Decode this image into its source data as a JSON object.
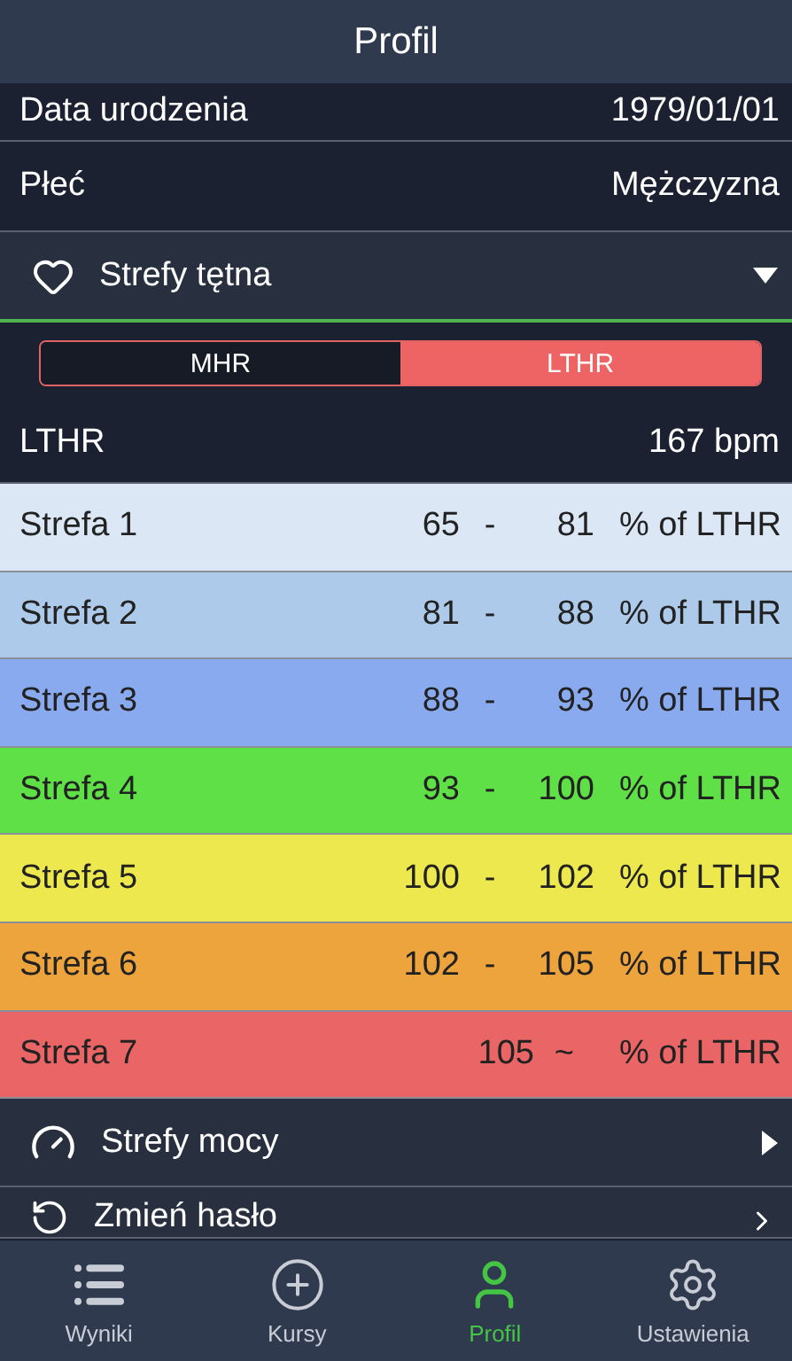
{
  "header": {
    "title": "Profil"
  },
  "fields": [
    {
      "label": "Data urodzenia",
      "value": "1979/01/01"
    },
    {
      "label": "Płeć",
      "value": "Mężczyzna"
    }
  ],
  "heart_section": {
    "title": "Strefy tętna",
    "expanded": true
  },
  "toggle": [
    {
      "label": "MHR",
      "selected": false
    },
    {
      "label": "LTHR",
      "selected": true
    }
  ],
  "threshold": {
    "label": "LTHR",
    "value": "167 bpm"
  },
  "zones": [
    {
      "name": "Strefa 1",
      "low": "65",
      "sep": "-",
      "high": "81",
      "unit": "% of LTHR",
      "color": "#dbe7f4"
    },
    {
      "name": "Strefa 2",
      "low": "81",
      "sep": "-",
      "high": "88",
      "unit": "% of LTHR",
      "color": "#aecaea"
    },
    {
      "name": "Strefa 3",
      "low": "88",
      "sep": "-",
      "high": "93",
      "unit": "% of LTHR",
      "color": "#8aaaf0"
    },
    {
      "name": "Strefa 4",
      "low": "93",
      "sep": "-",
      "high": "100",
      "unit": "% of LTHR",
      "color": "#5ee046"
    },
    {
      "name": "Strefa 5",
      "low": "100",
      "sep": "-",
      "high": "102",
      "unit": "% of LTHR",
      "color": "#ece84e"
    },
    {
      "name": "Strefa 6",
      "low": "102",
      "sep": "-",
      "high": "105",
      "unit": "% of LTHR",
      "color": "#eea43c"
    },
    {
      "name": "Strefa 7",
      "low": "105",
      "sep": "~",
      "unit": "% of LTHR",
      "color": "#ea6565"
    }
  ],
  "menu": [
    {
      "kind": "power",
      "title": "Strefy mocy"
    },
    {
      "kind": "password",
      "title": "Zmień hasło"
    }
  ],
  "nav": [
    {
      "kind": "list",
      "label": "Wyniki",
      "selected": false
    },
    {
      "kind": "plus",
      "label": "Kursy",
      "selected": false
    },
    {
      "kind": "user",
      "label": "Profil",
      "selected": true
    },
    {
      "kind": "gear",
      "label": "Ustawienia",
      "selected": false
    }
  ]
}
